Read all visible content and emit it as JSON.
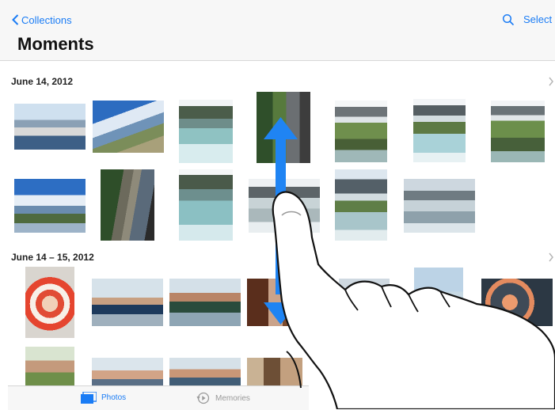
{
  "nav": {
    "back_label": "Collections",
    "select_label": "Select",
    "title": "Moments"
  },
  "sections": [
    {
      "date": "June 14, 2012"
    },
    {
      "date": "June 14 – 15, 2012"
    }
  ],
  "tabbar": {
    "photos_label": "Photos",
    "memories_label": "Memories"
  },
  "colors": {
    "accent": "#1a7cf5",
    "gesture_arrow": "#1f84f3"
  }
}
